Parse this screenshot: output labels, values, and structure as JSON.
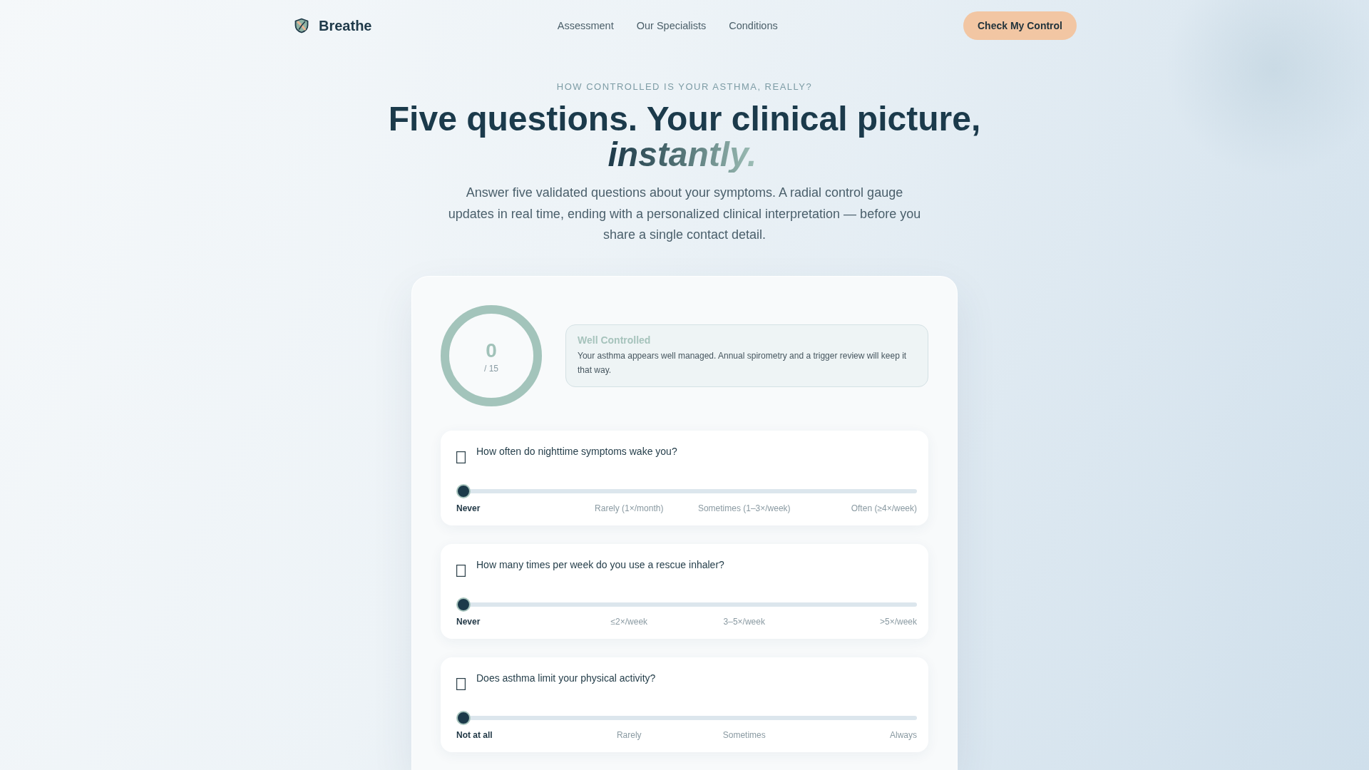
{
  "brand": {
    "name": "Breathe"
  },
  "nav": [
    "Assessment",
    "Our Specialists",
    "Conditions"
  ],
  "cta": "Check My Control",
  "hero": {
    "eyebrow": "HOW CONTROLLED IS YOUR ASTHMA, REALLY?",
    "headline": "Five questions. Your clinical picture,",
    "headline_emphasis": "instantly.",
    "intro": "Answer five validated questions about your symptoms. A radial control gauge updates in real time, ending with a personalized clinical interpretation — before you share a single contact detail."
  },
  "assessment": {
    "score": "0",
    "score_max": "/ 15",
    "status": {
      "title": "Well Controlled",
      "text": "Your asthma appears well managed. Annual spirometry and a trigger review will keep it that way."
    },
    "questions": [
      {
        "text": "How often do nighttime symptoms wake you?",
        "level": 0,
        "options": [
          {
            "label": "Never",
            "selected": true
          },
          {
            "label": "Rarely (1×/month)",
            "selected": false
          },
          {
            "label": "Sometimes (1–3×/week)",
            "selected": false
          },
          {
            "label": "Often (≥4×/week)",
            "selected": false
          }
        ]
      },
      {
        "text": "How many times per week do you use a rescue inhaler?",
        "level": 0,
        "options": [
          {
            "label": "Never",
            "selected": true
          },
          {
            "label": "≤2×/week",
            "selected": false
          },
          {
            "label": "3–5×/week",
            "selected": false
          },
          {
            "label": ">5×/week",
            "selected": false
          }
        ]
      },
      {
        "text": "Does asthma limit your physical activity?",
        "level": 0,
        "options": [
          {
            "label": "Not at all",
            "selected": true
          },
          {
            "label": "Rarely",
            "selected": false
          },
          {
            "label": "Sometimes",
            "selected": false
          },
          {
            "label": "Always",
            "selected": false
          }
        ]
      }
    ]
  }
}
